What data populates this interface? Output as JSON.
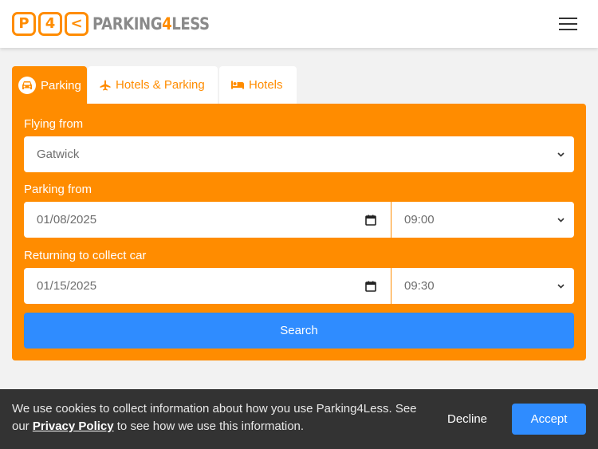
{
  "header": {
    "logo_letters": [
      "P",
      "4",
      "<"
    ],
    "logo_text_prefix": "PARKING",
    "logo_text_four": "4",
    "logo_text_suffix": "LESS",
    "menu_icon": "hamburger-menu-icon"
  },
  "tabs": [
    {
      "label": "Parking",
      "icon": "car-icon",
      "active": true
    },
    {
      "label": "Hotels & Parking",
      "icon": "plane-icon",
      "active": false
    },
    {
      "label": "Hotels",
      "icon": "bed-icon",
      "active": false
    }
  ],
  "form": {
    "flying_from_label": "Flying from",
    "flying_from_value": "Gatwick",
    "parking_from_label": "Parking from",
    "parking_from_date": "01/08/2025",
    "parking_from_time": "09:00",
    "returning_label": "Returning to collect car",
    "returning_date": "01/15/2025",
    "returning_time": "09:30",
    "search_label": "Search"
  },
  "cookie": {
    "text_before": "We use cookies to collect information about how you use Parking4Less. See our ",
    "link_label": "Privacy Policy",
    "text_after": " to see how we use this information.",
    "decline_label": "Decline",
    "accept_label": "Accept"
  },
  "colors": {
    "brand_orange": "#ff8c00",
    "accent_blue": "#2f8cff",
    "banner_dark": "#333333",
    "logo_grey": "#8a8a8a"
  }
}
